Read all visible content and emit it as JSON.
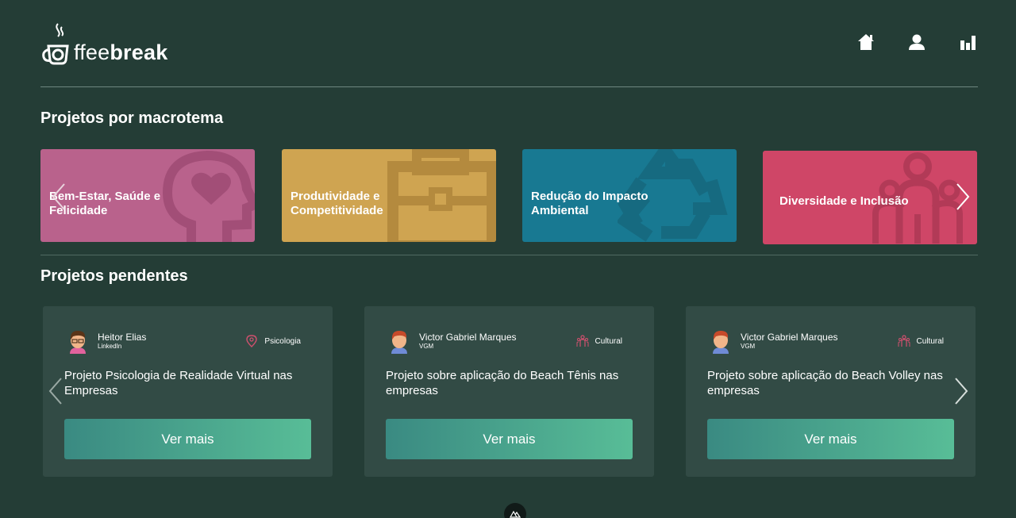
{
  "brand": {
    "logo_light": "ffee",
    "logo_bold": "break"
  },
  "nav": {
    "icons": [
      "home-icon",
      "user-icon",
      "bar-chart-icon"
    ]
  },
  "macrotemas": {
    "title": "Projetos por macrotema",
    "cards": [
      {
        "label": "Bem-Estar, Saúde e Felicidade",
        "color": "#b9628c",
        "icon": "head-heart-icon"
      },
      {
        "label": "Produtividade e Competitividade",
        "color": "#cfa451",
        "icon": "briefcase-icon"
      },
      {
        "label": "Redução do Impacto Ambiental",
        "color": "#187992",
        "icon": "recycle-icon"
      },
      {
        "label": "Diversidade e Inclusão",
        "color": "#cf4667",
        "icon": "people-icon"
      }
    ]
  },
  "pendentes": {
    "title": "Projetos pendentes",
    "cards": [
      {
        "author": "Heitor Elias",
        "sub": "LinkedIn",
        "tag": "Psicologia",
        "tag_icon": "location-pin-icon",
        "title": "Projeto Psicologia de Realidade Virtual nas Empresas",
        "button": "Ver mais"
      },
      {
        "author": "Victor Gabriel Marques",
        "sub": "VGM",
        "tag": "Cultural",
        "tag_icon": "people-icon",
        "title": "Projeto sobre aplicação do Beach Tênis nas empresas",
        "button": "Ver mais"
      },
      {
        "author": "Victor Gabriel Marques",
        "sub": "VGM",
        "tag": "Cultural",
        "tag_icon": "people-icon",
        "title": "Projeto sobre aplicação do Beach Volley nas empresas",
        "button": "Ver mais"
      }
    ]
  },
  "colors": {
    "background": "#243d36",
    "card": "#324b45",
    "button_start": "#3a8a82",
    "button_end": "#58bd97",
    "tag_icon": "#d0506e"
  }
}
